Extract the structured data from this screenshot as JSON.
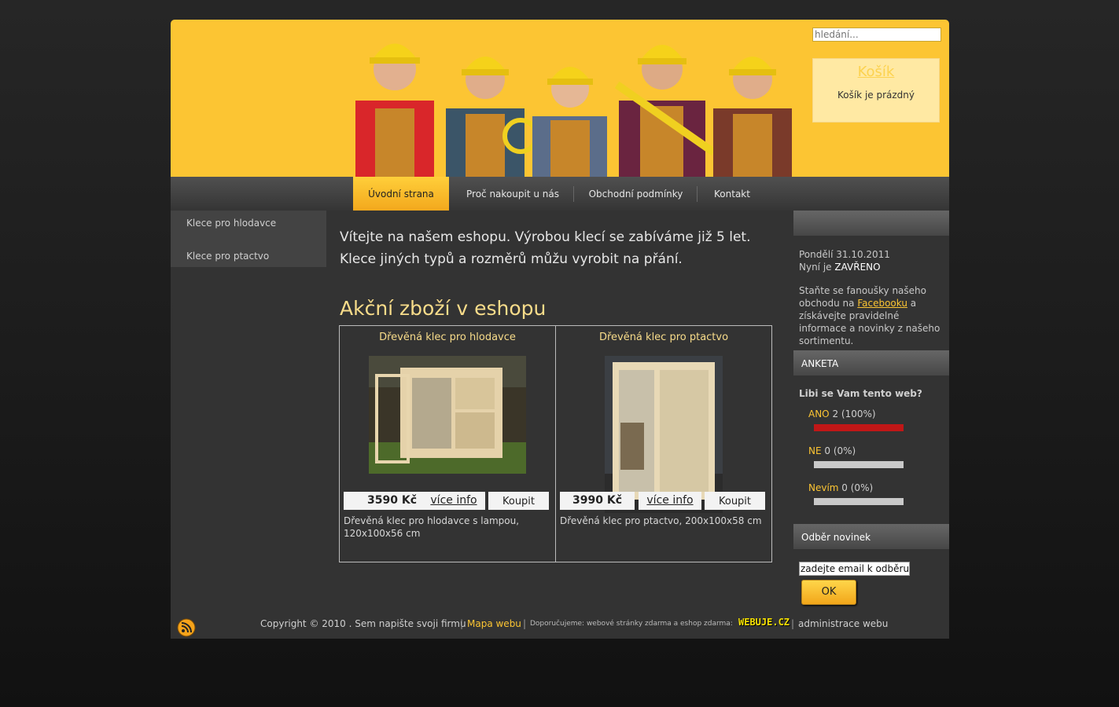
{
  "header": {
    "search_placeholder": "hledání...",
    "cart": {
      "title": "Košík",
      "empty_text": "Košík je prázdný"
    }
  },
  "nav": {
    "items": [
      {
        "label": "Úvodní strana"
      },
      {
        "label": "Proč nakoupit u nás"
      },
      {
        "label": "Obchodní podmínky"
      },
      {
        "label": "Kontakt"
      }
    ]
  },
  "left_menu": {
    "items": [
      {
        "label": "Klece pro hlodavce"
      },
      {
        "label": "Klece pro ptactvo"
      }
    ]
  },
  "main": {
    "intro_line1": "Vítejte na našem eshopu. Výrobou klecí se zabíváme již 5 let.",
    "intro_line2": "Klece jiných typů a rozměrů můžu vyrobit na přání.",
    "section_title": "Akční zboží v eshopu",
    "products": [
      {
        "title": "Dřevěná klec pro hlodavce",
        "price": "3590 Kč",
        "info_label": "více info",
        "buy_label": "Koupit",
        "description": "Dřevěná klec pro hlodavce s lampou, 120x100x56 cm"
      },
      {
        "title": "Dřevěná klec pro ptactvo",
        "price": "3990 Kč",
        "info_label": "více info",
        "buy_label": "Koupit",
        "description": "Dřevěná klec pro ptactvo, 200x100x58 cm"
      }
    ]
  },
  "right_sidebar": {
    "date": "Pondělí 31.10.2011",
    "now_prefix": "Nyní je ",
    "now_status": "ZAVŘENO",
    "fans_text_1": "Staňte se fanoušky našeho obchodu na ",
    "facebook_link": "Facebooku",
    "fans_text_2": " a získávejte pravidelné informace a novinky z našeho sortimentu.",
    "poll": {
      "title": "ANKETA",
      "question": "Libi se Vam tento web?",
      "options": [
        {
          "name": "ANO",
          "result": " 2 (100%)",
          "percent": 100
        },
        {
          "name": "NE",
          "result": " 0 (0%)",
          "percent": 0
        },
        {
          "name": "Nevím",
          "result": " 0 (0%)",
          "percent": 0
        }
      ]
    },
    "newsletter": {
      "title": "Odběr novinek",
      "input_value": "zadejte email k odběru",
      "button_label": "OK"
    }
  },
  "footer": {
    "copyright": "Copyright © 2010 . Sem napište svoji firmu",
    "sep": "|",
    "sitemap": "Mapa webu",
    "recommend": "Doporučujeme: webové stránky zdarma a eshop zdarma:",
    "logo_text": "WEBUJE.CZ",
    "admin": "administrace webu"
  },
  "colors": {
    "accent": "#fcc533",
    "poll_fill": "#c01717"
  }
}
